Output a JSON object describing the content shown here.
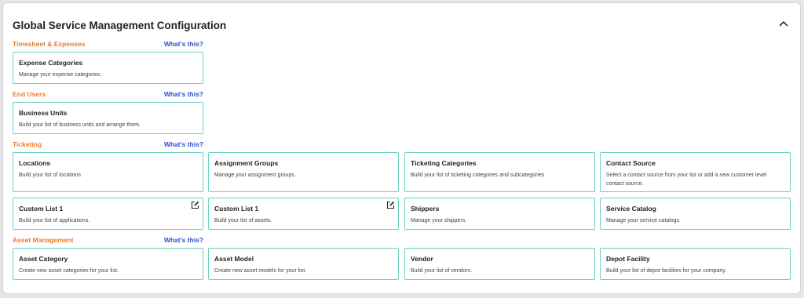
{
  "panel": {
    "title": "Global Service Management Configuration",
    "collapse_icon": "chevron-up-icon"
  },
  "accent_colors": {
    "section_title": "#f07a2a",
    "link": "#2a4fd6",
    "card_border": "#6ccfc2"
  },
  "sections": [
    {
      "title": "Timesheet & Expenses",
      "help_link": "What's this?",
      "cards": [
        {
          "title": "Expense Categories",
          "description": "Manage your expense categories."
        }
      ]
    },
    {
      "title": "End Users",
      "help_link": "What's this?",
      "cards": [
        {
          "title": "Business Units",
          "description": "Build your list of business units and arrange them."
        }
      ]
    },
    {
      "title": "Ticketing",
      "help_link": "What's this?",
      "cards": [
        {
          "title": "Locations",
          "description": "Build your list of locations"
        },
        {
          "title": "Assignment Groups",
          "description": "Manage your assignment groups."
        },
        {
          "title": "Ticketing Categories",
          "description": "Build your list of ticketing categories and subcategories."
        },
        {
          "title": "Contact Source",
          "description": "Select a contact source from your list or add a new customer level contact source."
        },
        {
          "title": "Custom List 1",
          "description": "Build your list of applications.",
          "icon": "edit-icon"
        },
        {
          "title": "Custom List 1",
          "description": "Build your list of assets.",
          "icon": "edit-icon"
        },
        {
          "title": "Shippers",
          "description": "Manage your shippers."
        },
        {
          "title": "Service Catalog",
          "description": "Manage your service catalogs."
        }
      ]
    },
    {
      "title": "Asset Management",
      "help_link": "What's this?",
      "cards": [
        {
          "title": "Asset Category",
          "description": "Create new asset categories for your list."
        },
        {
          "title": "Asset Model",
          "description": "Create new asset models for your list."
        },
        {
          "title": "Vendor",
          "description": "Build your list of vendors."
        },
        {
          "title": "Depot Facility",
          "description": "Build your list of depot facilities for your company."
        }
      ]
    }
  ]
}
